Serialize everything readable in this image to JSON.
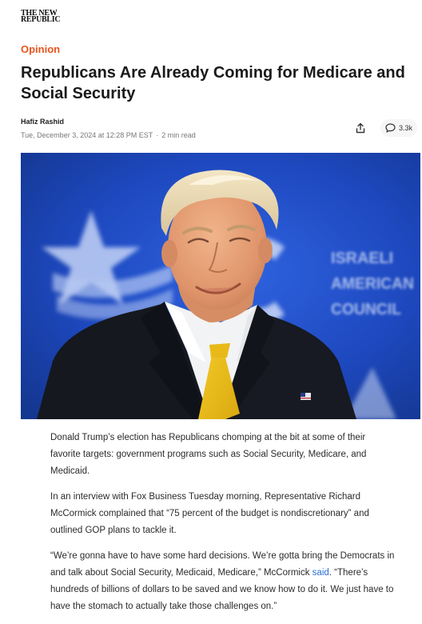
{
  "publication": {
    "logo_line1": "THE NEW",
    "logo_line2": "REPUBLIC"
  },
  "article": {
    "section": "Opinion",
    "title": "Republicans Are Already Coming for Medicare and Social Security",
    "author": "Hafiz Rashid",
    "date": "Tue, December 3, 2024 at 12:28 PM EST",
    "separator": "·",
    "read_time": "2 min read",
    "comment_count": "3.3k",
    "hero_sign_text": [
      "ISRAELI",
      "AMERICAN",
      "COUNCIL"
    ],
    "paragraphs": {
      "p1": "Donald Trump’s election has Republicans chomping at the bit at some of their favorite targets: government programs such as Social Security, Medicare, and Medicaid.",
      "p2": "In an interview with Fox Business Tuesday morning, Representative Richard McCormick complained that “75 percent of the budget is nondiscretionary” and outlined GOP plans to tackle it.",
      "p3_before": "“We’re gonna have to have some hard decisions. We’re gotta bring the Democrats in and talk about Social Security, Medicaid, Medicare,” McCormick ",
      "p3_link": "said",
      "p3_after": ". “There’s hundreds of billions of dollars to be saved and we know how to do it. We just have to have the stomach to actually take those challenges on.”"
    }
  },
  "icons": {
    "share": "share-icon",
    "comment": "comment-icon"
  },
  "colors": {
    "accent": "#e8541e",
    "link": "#2f6fd6",
    "hero_bg": "#1d47bc"
  }
}
